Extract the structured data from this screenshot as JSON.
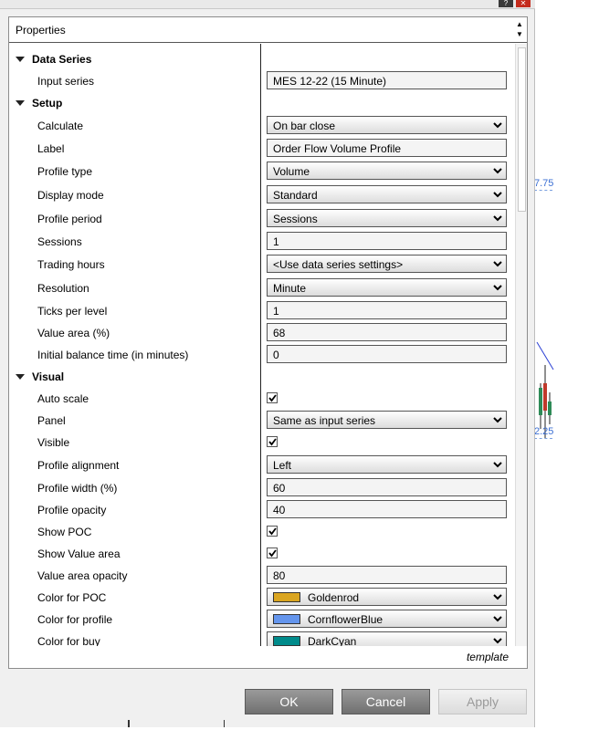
{
  "panel": {
    "title": "Properties",
    "template_link": "template"
  },
  "chart_peek": {
    "label_top": "7.75",
    "label_mid": "2.25"
  },
  "categories": {
    "data_series": "Data Series",
    "setup": "Setup",
    "visual": "Visual"
  },
  "props": {
    "input_series": {
      "label": "Input series",
      "value": "MES 12-22 (15 Minute)"
    },
    "calculate": {
      "label": "Calculate",
      "value": "On bar close"
    },
    "label": {
      "label": "Label",
      "value": "Order Flow Volume Profile"
    },
    "profile_type": {
      "label": "Profile type",
      "value": "Volume"
    },
    "display_mode": {
      "label": "Display mode",
      "value": "Standard"
    },
    "profile_period": {
      "label": "Profile period",
      "value": "Sessions"
    },
    "sessions": {
      "label": "Sessions",
      "value": "1"
    },
    "trading_hours": {
      "label": "Trading hours",
      "value": "<Use data series settings>"
    },
    "resolution": {
      "label": "Resolution",
      "value": "Minute"
    },
    "ticks_per_level": {
      "label": "Ticks per level",
      "value": "1"
    },
    "value_area": {
      "label": "Value area (%)",
      "value": "68"
    },
    "ib_time": {
      "label": "Initial balance time (in minutes)",
      "value": "0"
    },
    "auto_scale": {
      "label": "Auto scale",
      "checked": true
    },
    "panel": {
      "label": "Panel",
      "value": "Same as input series"
    },
    "visible": {
      "label": "Visible",
      "checked": true
    },
    "profile_alignment": {
      "label": "Profile alignment",
      "value": "Left"
    },
    "profile_width": {
      "label": "Profile width (%)",
      "value": "60"
    },
    "profile_opacity": {
      "label": "Profile opacity",
      "value": "40"
    },
    "show_poc": {
      "label": "Show POC",
      "checked": true
    },
    "show_value_area": {
      "label": "Show Value area",
      "checked": true
    },
    "value_area_opacity": {
      "label": "Value area opacity",
      "value": "80"
    },
    "color_poc": {
      "label": "Color for POC",
      "value": "Goldenrod",
      "color": "#DAA520"
    },
    "color_profile": {
      "label": "Color for profile",
      "value": "CornflowerBlue",
      "color": "#6495ED"
    },
    "color_buy": {
      "label": "Color for buy",
      "value": "DarkCyan",
      "color": "#008B8B"
    }
  },
  "buttons": {
    "ok": "OK",
    "cancel": "Cancel",
    "apply": "Apply"
  }
}
